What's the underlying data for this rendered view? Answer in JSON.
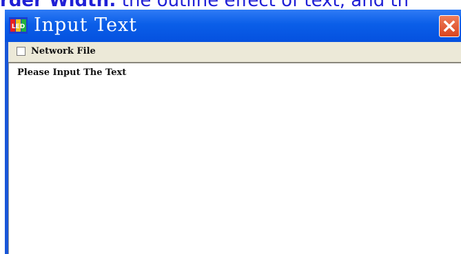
{
  "background_caption": {
    "bold_part": "rder Width:",
    "rest": " the outline effect of text, and th"
  },
  "window": {
    "title": "Input Text",
    "app_icon": "led-logo-icon",
    "close_icon": "close-x-icon"
  },
  "toolbar": {
    "network_file_label": "Network File",
    "network_file_checked": false
  },
  "editor": {
    "placeholder": "Please Input The Text"
  },
  "colors": {
    "titlebar_blue": "#0a5ee8",
    "close_red": "#d9451f",
    "toolbar_bg": "#ece9d8",
    "caption_blue": "#1f1fd6"
  }
}
